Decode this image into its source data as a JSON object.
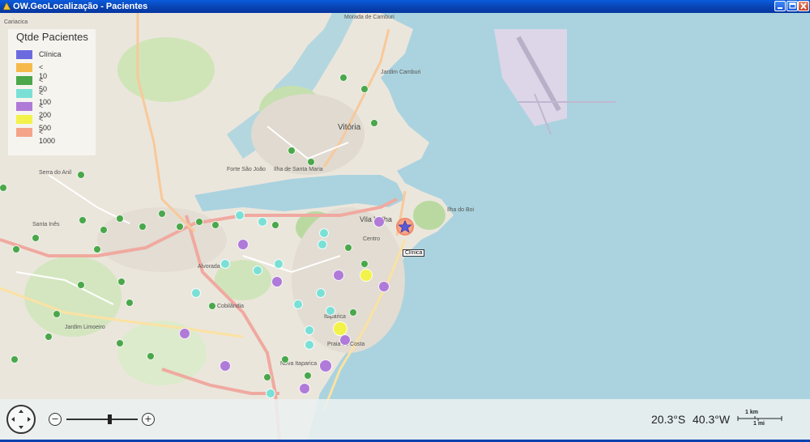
{
  "window": {
    "title": "OW.GeoLocalização - Pacientes",
    "controls": {
      "minimize": "minimize",
      "maximize": "maximize",
      "close": "close"
    }
  },
  "legend": {
    "title": "Qtde Pacientes",
    "items": [
      {
        "label": "Clínica",
        "color": "#6b6bdf"
      },
      {
        "label": "< 10",
        "color": "#f6b94a"
      },
      {
        "label": "< 50",
        "color": "#4aa74a"
      },
      {
        "label": "< 100",
        "color": "#7ae0d6"
      },
      {
        "label": "< 200",
        "color": "#b07ad8"
      },
      {
        "label": "< 500",
        "color": "#f2f24a"
      },
      {
        "label": "< 1000",
        "color": "#f5a488"
      }
    ]
  },
  "map": {
    "clinic_tooltip": "Clínica",
    "place_labels": [
      "Vitória",
      "Vila Velha",
      "Ilha de Santa Maria",
      "Jardim Camburi",
      "Praia da Costa",
      "Centro",
      "Cariacica",
      "Serra do Anil",
      "Jardim Limoeiro",
      "Santa Inês",
      "Forte São João",
      "Ilha do Boi",
      "Itaparica",
      "Nova Itaparica",
      "Jardim Camburi",
      "Morada de Camburi",
      "Cobilândia",
      "Alvorada"
    ]
  },
  "footer": {
    "latitude": "20.3°S",
    "longitude": "40.3°W",
    "scale_km": "1 km",
    "scale_mi": "1 mi",
    "zoom_out": "−",
    "zoom_in": "+"
  }
}
